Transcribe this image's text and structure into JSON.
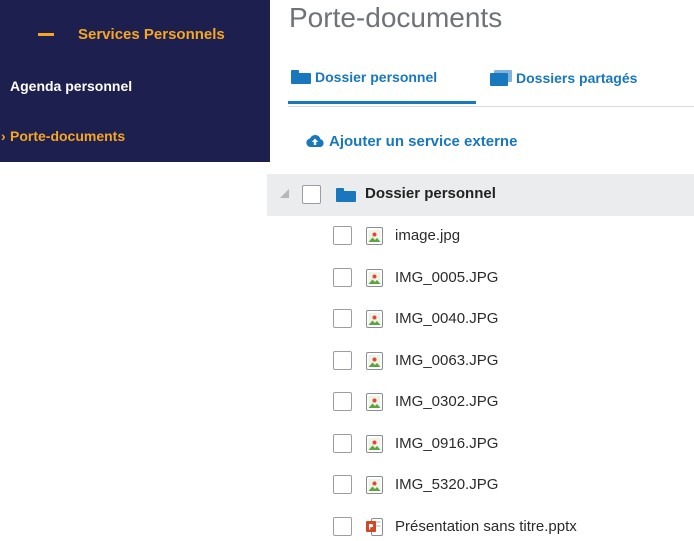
{
  "sidebar": {
    "header": "Services Personnels",
    "items": [
      {
        "label": "Agenda personnel"
      },
      {
        "label": "Porte-documents",
        "active_marker": "›"
      }
    ]
  },
  "main": {
    "title": "Porte-documents",
    "tabs": [
      {
        "label": "Dossier personnel",
        "icon": "folder-icon",
        "active": true
      },
      {
        "label": "Dossiers partagés",
        "icon": "folders-icon",
        "active": false
      }
    ],
    "add_external_service": "Ajouter un service externe",
    "tree": {
      "root": "Dossier personnel",
      "files": [
        {
          "name": "image.jpg",
          "type": "image"
        },
        {
          "name": "IMG_0005.JPG",
          "type": "image"
        },
        {
          "name": "IMG_0040.JPG",
          "type": "image"
        },
        {
          "name": "IMG_0063.JPG",
          "type": "image"
        },
        {
          "name": "IMG_0302.JPG",
          "type": "image"
        },
        {
          "name": "IMG_0916.JPG",
          "type": "image"
        },
        {
          "name": "IMG_5320.JPG",
          "type": "image"
        },
        {
          "name": "Présentation sans titre.pptx",
          "type": "powerpoint"
        }
      ]
    }
  },
  "colors": {
    "sidebar_bg": "#1d1f4e",
    "accent_orange": "#f5a623",
    "link_blue": "#1877bd",
    "title_gray": "#6f7378",
    "row_highlight": "#eaeced"
  }
}
